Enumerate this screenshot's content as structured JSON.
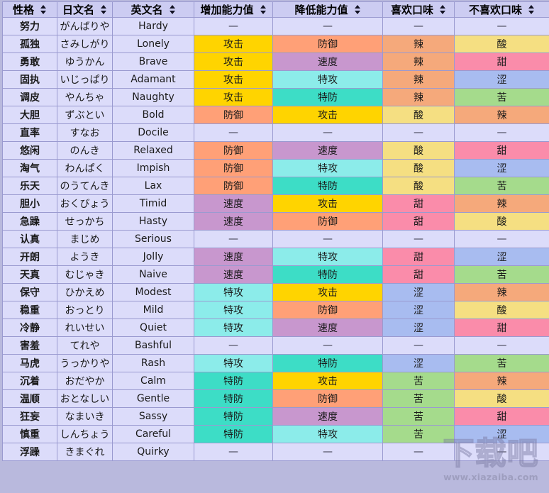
{
  "table": {
    "sort_icon": "sort-updown-icon",
    "columns": [
      {
        "key": "name",
        "label": "性格",
        "sortable": true
      },
      {
        "key": "jp",
        "label": "日文名",
        "sortable": true
      },
      {
        "key": "en",
        "label": "英文名",
        "sortable": true
      },
      {
        "key": "up",
        "label": "增加能力值",
        "sortable": true
      },
      {
        "key": "down",
        "label": "降低能力值",
        "sortable": true
      },
      {
        "key": "like",
        "label": "喜欢口味",
        "sortable": true
      },
      {
        "key": "dislike",
        "label": "不喜欢口味",
        "sortable": true
      }
    ],
    "dash": "—",
    "rows": [
      {
        "name": "努力",
        "jp": "がんばりや",
        "en": "Hardy",
        "up": "—",
        "down": "—",
        "like": "—",
        "dislike": "—"
      },
      {
        "name": "孤独",
        "jp": "さみしがり",
        "en": "Lonely",
        "up": "攻击",
        "down": "防御",
        "like": "辣",
        "dislike": "酸"
      },
      {
        "name": "勇敢",
        "jp": "ゆうかん",
        "en": "Brave",
        "up": "攻击",
        "down": "速度",
        "like": "辣",
        "dislike": "甜"
      },
      {
        "name": "固执",
        "jp": "いじっぱり",
        "en": "Adamant",
        "up": "攻击",
        "down": "特攻",
        "like": "辣",
        "dislike": "涩"
      },
      {
        "name": "调皮",
        "jp": "やんちゃ",
        "en": "Naughty",
        "up": "攻击",
        "down": "特防",
        "like": "辣",
        "dislike": "苦"
      },
      {
        "name": "大胆",
        "jp": "ずぶとい",
        "en": "Bold",
        "up": "防御",
        "down": "攻击",
        "like": "酸",
        "dislike": "辣"
      },
      {
        "name": "直率",
        "jp": "すなお",
        "en": "Docile",
        "up": "—",
        "down": "—",
        "like": "—",
        "dislike": "—"
      },
      {
        "name": "悠闲",
        "jp": "のんき",
        "en": "Relaxed",
        "up": "防御",
        "down": "速度",
        "like": "酸",
        "dislike": "甜"
      },
      {
        "name": "淘气",
        "jp": "わんぱく",
        "en": "Impish",
        "up": "防御",
        "down": "特攻",
        "like": "酸",
        "dislike": "涩"
      },
      {
        "name": "乐天",
        "jp": "のうてんき",
        "en": "Lax",
        "up": "防御",
        "down": "特防",
        "like": "酸",
        "dislike": "苦"
      },
      {
        "name": "胆小",
        "jp": "おくびょう",
        "en": "Timid",
        "up": "速度",
        "down": "攻击",
        "like": "甜",
        "dislike": "辣"
      },
      {
        "name": "急躁",
        "jp": "せっかち",
        "en": "Hasty",
        "up": "速度",
        "down": "防御",
        "like": "甜",
        "dislike": "酸"
      },
      {
        "name": "认真",
        "jp": "まじめ",
        "en": "Serious",
        "up": "—",
        "down": "—",
        "like": "—",
        "dislike": "—"
      },
      {
        "name": "开朗",
        "jp": "ようき",
        "en": "Jolly",
        "up": "速度",
        "down": "特攻",
        "like": "甜",
        "dislike": "涩"
      },
      {
        "name": "天真",
        "jp": "むじゃき",
        "en": "Naive",
        "up": "速度",
        "down": "特防",
        "like": "甜",
        "dislike": "苦"
      },
      {
        "name": "保守",
        "jp": "ひかえめ",
        "en": "Modest",
        "up": "特攻",
        "down": "攻击",
        "like": "涩",
        "dislike": "辣"
      },
      {
        "name": "稳重",
        "jp": "おっとり",
        "en": "Mild",
        "up": "特攻",
        "down": "防御",
        "like": "涩",
        "dislike": "酸"
      },
      {
        "name": "冷静",
        "jp": "れいせい",
        "en": "Quiet",
        "up": "特攻",
        "down": "速度",
        "like": "涩",
        "dislike": "甜"
      },
      {
        "name": "害羞",
        "jp": "てれや",
        "en": "Bashful",
        "up": "—",
        "down": "—",
        "like": "—",
        "dislike": "—"
      },
      {
        "name": "马虎",
        "jp": "うっかりや",
        "en": "Rash",
        "up": "特攻",
        "down": "特防",
        "like": "涩",
        "dislike": "苦"
      },
      {
        "name": "沉着",
        "jp": "おだやか",
        "en": "Calm",
        "up": "特防",
        "down": "攻击",
        "like": "苦",
        "dislike": "辣"
      },
      {
        "name": "温顺",
        "jp": "おとなしい",
        "en": "Gentle",
        "up": "特防",
        "down": "防御",
        "like": "苦",
        "dislike": "酸"
      },
      {
        "name": "狂妄",
        "jp": "なまいき",
        "en": "Sassy",
        "up": "特防",
        "down": "速度",
        "like": "苦",
        "dislike": "甜"
      },
      {
        "name": "慎重",
        "jp": "しんちょう",
        "en": "Careful",
        "up": "特防",
        "down": "特攻",
        "like": "苦",
        "dislike": "涩"
      },
      {
        "name": "浮躁",
        "jp": "きまぐれ",
        "en": "Quirky",
        "up": "—",
        "down": "—",
        "like": "—",
        "dislike": "—"
      }
    ]
  },
  "colors": {
    "page_background": "#b9b9dd",
    "grid_border": "#9a9ad0",
    "header_background": "#ccccf2",
    "cell_background": "#dcdcfa",
    "stat_attack": "#ffd400",
    "stat_defense": "#ffa077",
    "stat_speed": "#c897ce",
    "stat_spatk": "#8cecea",
    "stat_spdef": "#3dddc6",
    "flavor_spicy": "#f5a97b",
    "flavor_sour": "#f5df82",
    "flavor_sweet": "#fa8caa",
    "flavor_dry": "#a8bcf0",
    "flavor_bitter": "#a5db8c"
  },
  "watermark": {
    "text": "下载吧",
    "url": "www.xiazaiba.com"
  }
}
